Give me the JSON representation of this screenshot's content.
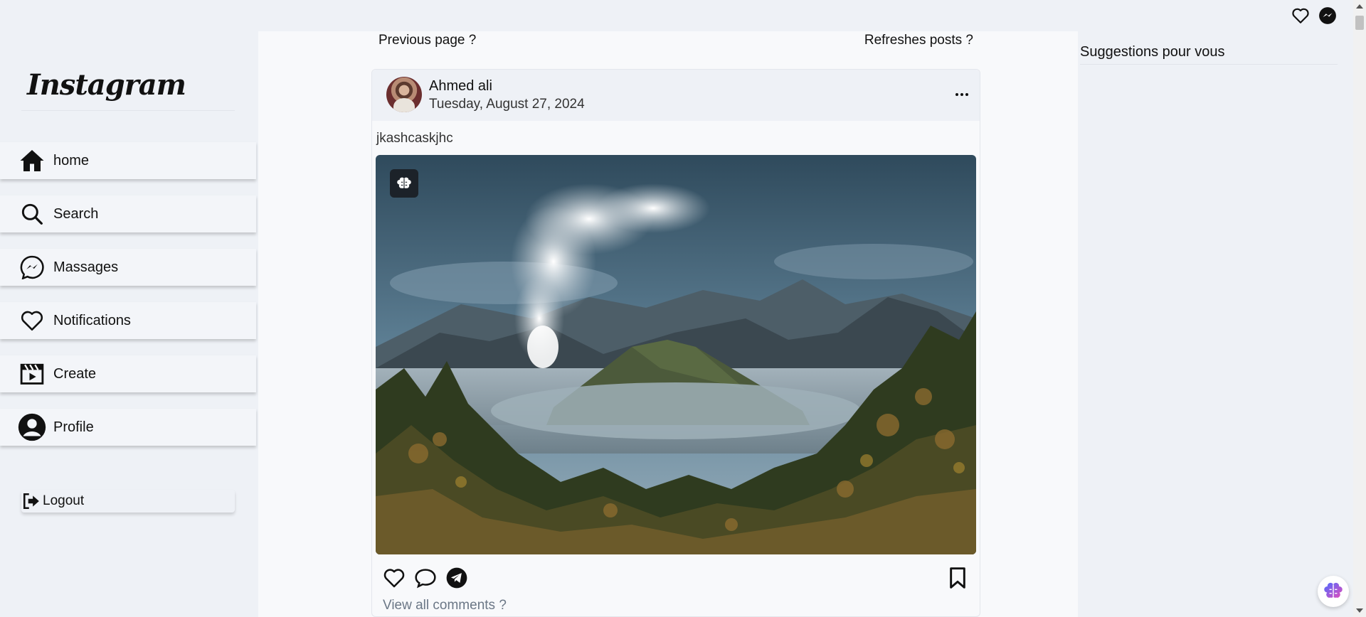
{
  "brand": {
    "logo_text": "Instagram"
  },
  "sidebar": {
    "items": [
      {
        "label": "home",
        "icon": "home-icon"
      },
      {
        "label": "Search",
        "icon": "search-icon"
      },
      {
        "label": "Massages",
        "icon": "messenger-icon"
      },
      {
        "label": "Notifications",
        "icon": "heart-icon"
      },
      {
        "label": "Create",
        "icon": "clapperboard-icon"
      },
      {
        "label": "Profile",
        "icon": "user-icon"
      }
    ],
    "logout_label": "Logout"
  },
  "feed": {
    "previous_page": "Previous page ?",
    "refresh_posts": "Refreshes posts ?"
  },
  "post": {
    "user": "Ahmed ali",
    "date": "Tuesday, August 27, 2024",
    "caption": "jkashcaskjhc",
    "view_comments": "View all comments ?"
  },
  "suggestions": {
    "title": "Suggestions pour vous"
  },
  "colors": {
    "background": "#eef1f6",
    "feed_bg": "#f8f9fb",
    "muted_text": "#6b7786"
  }
}
